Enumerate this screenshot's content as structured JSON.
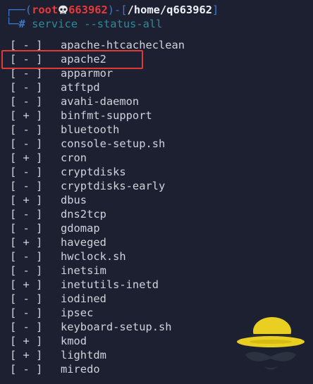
{
  "prompt": {
    "frame_top": "┌──(",
    "user": "root",
    "host": "663962",
    "mid": ")-[",
    "path": "/home/q663962",
    "end": "]",
    "frame_bottom": "└─",
    "hash": "#",
    "command": "service --status-all",
    "skull_icon": "skull-icon"
  },
  "services": [
    {
      "status": "[ - ]",
      "name": "apache-htcacheclean"
    },
    {
      "status": "[ - ]",
      "name": "apache2",
      "highlighted": true
    },
    {
      "status": "[ - ]",
      "name": "apparmor"
    },
    {
      "status": "[ - ]",
      "name": "atftpd"
    },
    {
      "status": "[ - ]",
      "name": "avahi-daemon"
    },
    {
      "status": "[ + ]",
      "name": "binfmt-support"
    },
    {
      "status": "[ - ]",
      "name": "bluetooth"
    },
    {
      "status": "[ - ]",
      "name": "console-setup.sh"
    },
    {
      "status": "[ + ]",
      "name": "cron"
    },
    {
      "status": "[ - ]",
      "name": "cryptdisks"
    },
    {
      "status": "[ - ]",
      "name": "cryptdisks-early"
    },
    {
      "status": "[ + ]",
      "name": "dbus"
    },
    {
      "status": "[ - ]",
      "name": "dns2tcp"
    },
    {
      "status": "[ - ]",
      "name": "gdomap"
    },
    {
      "status": "[ + ]",
      "name": "haveged"
    },
    {
      "status": "[ - ]",
      "name": "hwclock.sh"
    },
    {
      "status": "[ - ]",
      "name": "inetsim"
    },
    {
      "status": "[ + ]",
      "name": "inetutils-inetd"
    },
    {
      "status": "[ - ]",
      "name": "iodined"
    },
    {
      "status": "[ - ]",
      "name": "ipsec"
    },
    {
      "status": "[ - ]",
      "name": "keyboard-setup.sh"
    },
    {
      "status": "[ + ]",
      "name": "kmod"
    },
    {
      "status": "[ + ]",
      "name": "lightdm"
    },
    {
      "status": "[ - ]",
      "name": "miredo"
    }
  ],
  "colors": {
    "background": "#1d2030",
    "highlight_border": "#e03a37",
    "prompt_blue": "#3b78c9",
    "prompt_red": "#e63939",
    "command_teal": "#2f8a9c"
  },
  "logo_icon": "hat-mustache-logo-icon"
}
